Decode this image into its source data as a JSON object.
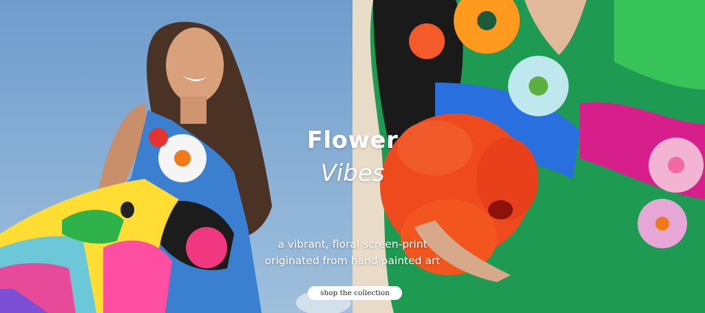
{
  "hero": {
    "title_bold": "Flower",
    "title_italic": "Vibes",
    "subtitle_line1": "a vibrant, floral screen-print",
    "subtitle_line2": "originated from hand painted art",
    "cta_label": "shop the collection"
  },
  "colors": {
    "sky": "#7aa4cf",
    "text": "#ffffff",
    "button_bg": "#ffffff",
    "hibiscus": "#f04a1e"
  },
  "images": {
    "left": "woman-in-floral-dress-sky-photo",
    "right": "floral-dress-hibiscus-closeup-photo"
  }
}
